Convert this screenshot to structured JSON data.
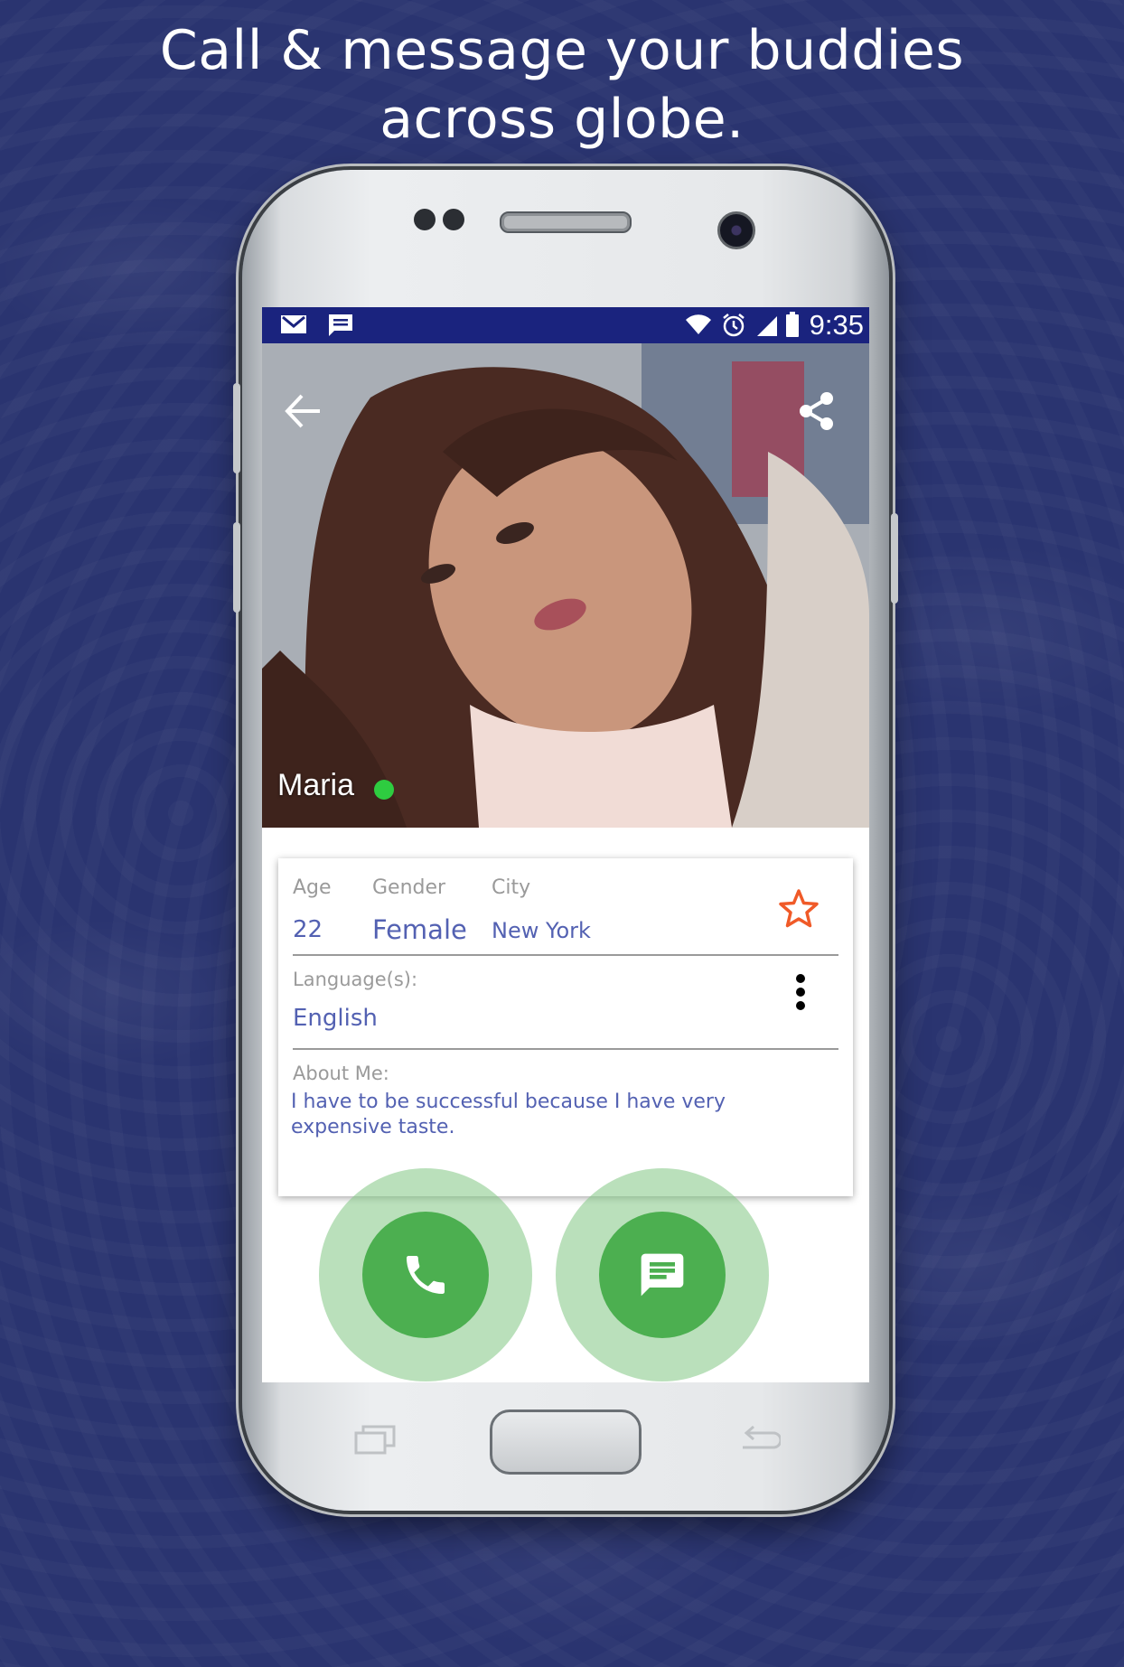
{
  "headline": {
    "line1": "Call & message  your buddies",
    "line2": "across globe."
  },
  "status_bar": {
    "time": "9:35",
    "left_icons": [
      "gmail-icon",
      "message-icon"
    ],
    "right_icons": [
      "wifi-icon",
      "alarm-icon",
      "signal-icon",
      "battery-icon"
    ]
  },
  "profile": {
    "name": "Maria",
    "online": true,
    "photo_subject": "profile photo"
  },
  "details": {
    "age_label": "Age",
    "age_value": "22",
    "gender_label": "Gender",
    "gender_value": "Female",
    "city_label": "City",
    "city_value": "New York",
    "languages_label": "Language(s):",
    "languages_value": "English",
    "about_label": "About Me:",
    "about_value": "I have to be successful because I have very expensive taste."
  },
  "actions": {
    "call_icon": "phone-icon",
    "message_icon": "chat-icon"
  },
  "colors": {
    "background": "#2a3470",
    "status_bar": "#1a237e",
    "accent_text": "#5361b2",
    "fab": "#4caf50",
    "fab_halo": "#81c784",
    "star": "#f05a28",
    "online": "#2ecc40"
  }
}
